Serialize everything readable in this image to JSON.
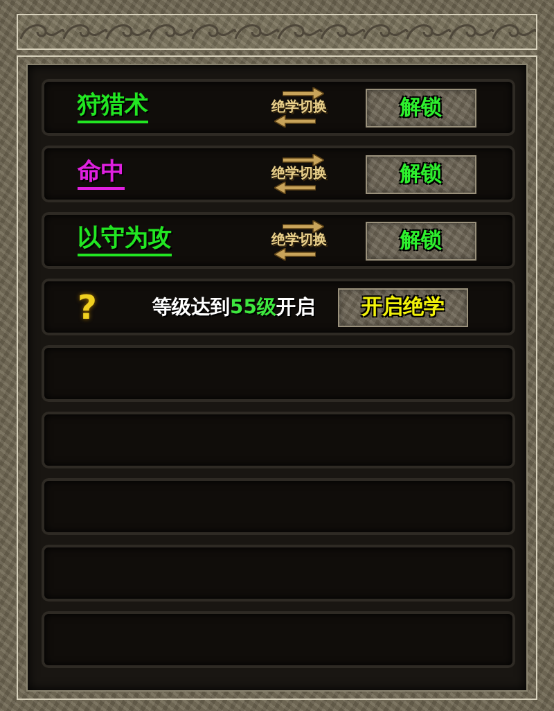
{
  "rows": [
    {
      "kind": "skill",
      "name": "狩猎术",
      "color": "#22e622",
      "swap": "绝学切换",
      "button": "解锁"
    },
    {
      "kind": "skill",
      "name": "命中",
      "color": "#e020e0",
      "swap": "绝学切换",
      "button": "解锁"
    },
    {
      "kind": "skill",
      "name": "以守为攻",
      "color": "#22e622",
      "swap": "绝学切换",
      "button": "解锁"
    },
    {
      "kind": "locked",
      "mark": "?",
      "requirement": {
        "before": "等级达到",
        "level": "55级",
        "after": "开启"
      },
      "button": "开启绝学"
    },
    {
      "kind": "empty"
    },
    {
      "kind": "empty"
    },
    {
      "kind": "empty"
    },
    {
      "kind": "empty"
    },
    {
      "kind": "empty"
    }
  ]
}
